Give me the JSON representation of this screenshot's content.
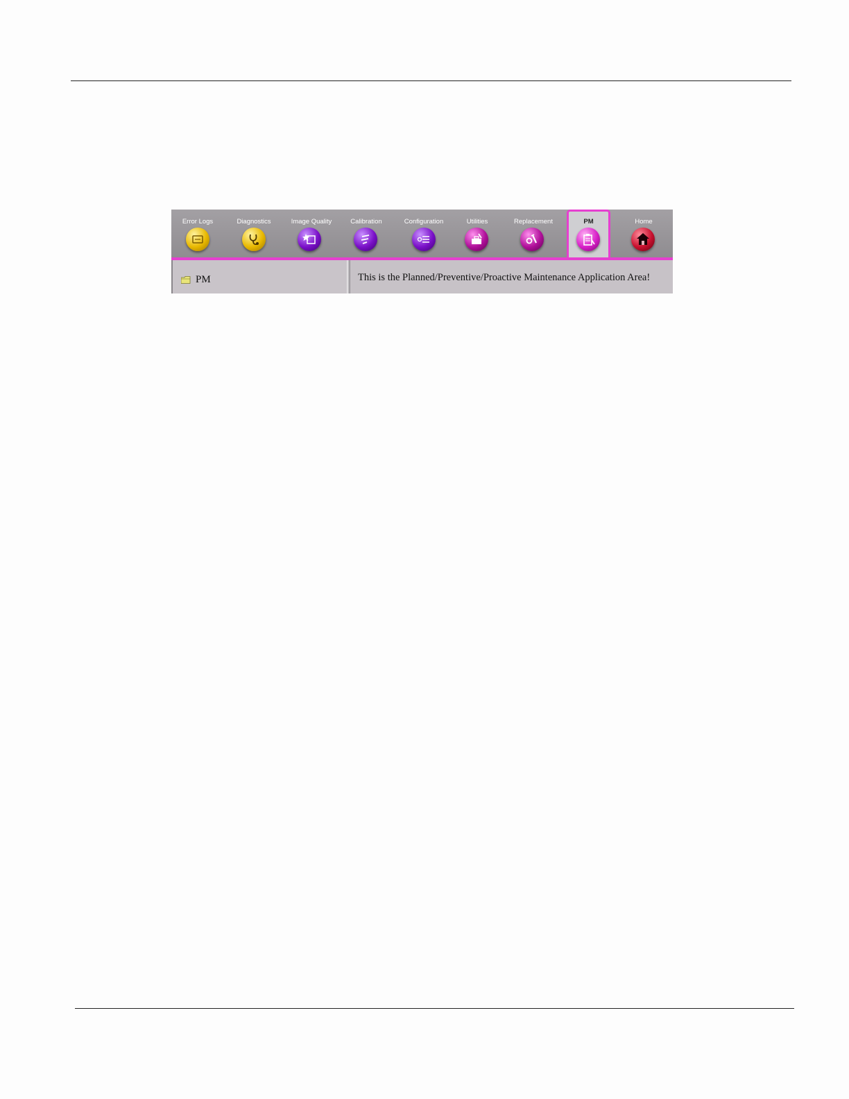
{
  "toolbar": {
    "items": [
      {
        "label": "Error Logs",
        "icon": "error-logs-icon",
        "color": "#e8b800",
        "active": false
      },
      {
        "label": "Diagnostics",
        "icon": "stethoscope-icon",
        "color": "#e8b800",
        "active": false
      },
      {
        "label": "Image Quality",
        "icon": "image-quality-icon",
        "color": "#7a10c8",
        "active": false
      },
      {
        "label": "Calibration",
        "icon": "calibration-icon",
        "color": "#7a10c8",
        "active": false
      },
      {
        "label": "Configuration",
        "icon": "configuration-icon",
        "color": "#7a10c8",
        "active": false
      },
      {
        "label": "Utilities",
        "icon": "utilities-icon",
        "color": "#b0109a",
        "active": false
      },
      {
        "label": "Replacement",
        "icon": "replacement-icon",
        "color": "#b0109a",
        "active": false
      },
      {
        "label": "PM",
        "icon": "pm-clipboard-icon",
        "color": "#d820c8",
        "active": true
      },
      {
        "label": "Home",
        "icon": "home-icon",
        "color": "#c8102e",
        "active": false
      }
    ]
  },
  "tree": {
    "items": [
      {
        "label": "PM",
        "icon": "folder-icon"
      }
    ]
  },
  "content": {
    "message": "This is the Planned/Preventive/Proactive Maintenance Application Area!"
  },
  "colors": {
    "accent": "#e63fd0"
  }
}
